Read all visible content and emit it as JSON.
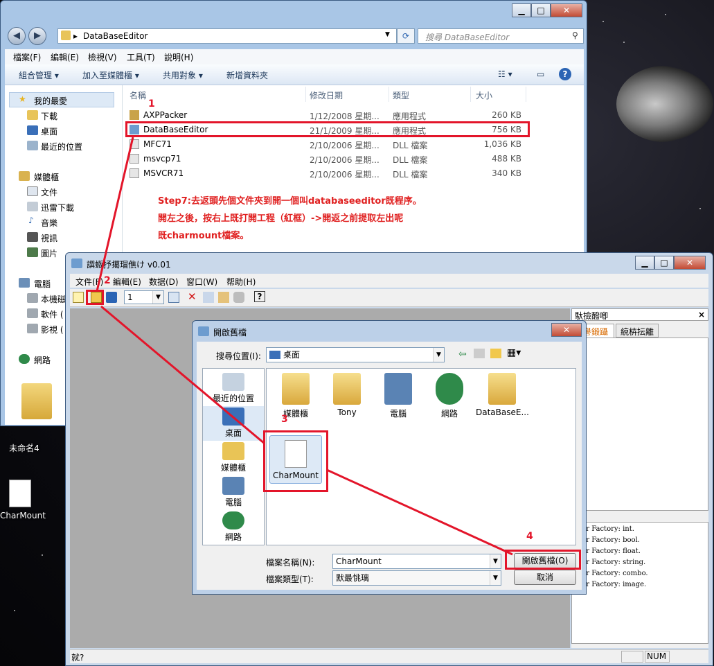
{
  "explorer": {
    "address": "DataBaseEditor",
    "search_placeholder": "搜尋 DataBaseEditor",
    "menu": [
      "檔案(F)",
      "編輯(E)",
      "檢視(V)",
      "工具(T)",
      "說明(H)"
    ],
    "toolbar": [
      "組合管理",
      "加入至媒體櫃",
      "共用對象",
      "新增資料夾"
    ],
    "nav": {
      "favorites": "我的最愛",
      "favorites_items": [
        "下載",
        "桌面",
        "最近的位置"
      ],
      "libraries": "媒體櫃",
      "libraries_items": [
        "文件",
        "迅雷下載",
        "音樂",
        "視訊",
        "圖片"
      ],
      "computer": "電腦",
      "computer_items": [
        "本機磁",
        "軟件 (",
        "影視 ("
      ],
      "network": "網路"
    },
    "columns": [
      "名稱",
      "修改日期",
      "類型",
      "大小"
    ],
    "files": [
      {
        "name": "AXPPacker",
        "date": "1/12/2008 星期...",
        "type": "應用程式",
        "size": "260 KB"
      },
      {
        "name": "DataBaseEditor",
        "date": "21/1/2009 星期...",
        "type": "應用程式",
        "size": "756 KB"
      },
      {
        "name": "MFC71",
        "date": "2/10/2006 星期...",
        "type": "DLL 檔案",
        "size": "1,036 KB"
      },
      {
        "name": "msvcp71",
        "date": "2/10/2006 星期...",
        "type": "DLL 檔案",
        "size": "488 KB"
      },
      {
        "name": "MSVCR71",
        "date": "2/10/2006 星期...",
        "type": "DLL 檔案",
        "size": "340 KB"
      }
    ],
    "step_text": [
      "Step7:去返頭先個文件夾到開一個叫databaseeditor既程序。",
      "開左之後，按右上既打開工程（紅框）->開返之前提取左出呢",
      "既charmount檔案。"
    ]
  },
  "dbe": {
    "title": "譔蝂抒擖瑁僬け v0.01",
    "menu": [
      "文件(F)",
      "編輯(E)",
      "数据(D)",
      "窗口(W)",
      "帮助(H)"
    ],
    "toolbar_combo": "1",
    "right_panel_title": "馱撿醱喞",
    "right_tabs": [
      "譽鍛躡桶",
      "綂枿抎離"
    ],
    "log_lines": [
      "ister Factory: int.",
      "ister Factory: bool.",
      "ister Factory: float.",
      "ister Factory: string.",
      "ister Factory: combo.",
      "ister Factory: image."
    ],
    "status_left": "就?",
    "status_num": "NUM"
  },
  "dialog": {
    "title": "開啟舊檔",
    "lookin_label": "搜尋位置(I):",
    "lookin_value": "桌面",
    "places": [
      "最近的位置",
      "桌面",
      "媒體櫃",
      "電腦",
      "網路"
    ],
    "items": [
      "媒體櫃",
      "Tony",
      "電腦",
      "網路",
      "DataBaseE...",
      "CharMount"
    ],
    "filename_label": "檔案名稱(N):",
    "filename_value": "CharMount",
    "filetype_label": "檔案類型(T):",
    "filetype_value": "默最恌璃",
    "open_button": "開啟舊檔(O)",
    "cancel_button": "取消"
  },
  "desktop": {
    "icons": [
      "未命名4",
      "CharMount"
    ]
  },
  "annotations": [
    "1",
    "2",
    "3",
    "4"
  ],
  "colors": {
    "annotation": "#e3152a",
    "step_text": "#e02020",
    "accent": "#3b5a80"
  }
}
